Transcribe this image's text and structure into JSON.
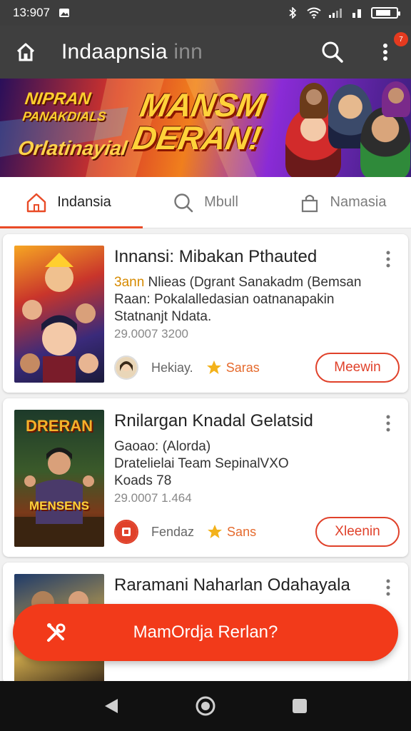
{
  "status": {
    "time": "13:907"
  },
  "appbar": {
    "title": "Indaapnsia",
    "title_suffix": "inn",
    "notification_count": "7"
  },
  "banner": {
    "left_line1": "NIPRAN",
    "left_line2": "PANAKDIALS",
    "left_line3": "Orlatinayial",
    "headline_line1": "MANSM",
    "headline_line2": "DERAN!"
  },
  "tabs": [
    {
      "label": "Indansia"
    },
    {
      "label": "Mbull"
    },
    {
      "label": "Namasia"
    }
  ],
  "cards": [
    {
      "title": "Innansi: Mibakan Pthauted",
      "desc_highlight": "3ann",
      "desc_line1": " Nlieas (Dgrant Sanakadm (Bemsan",
      "desc_line2": "Raan: Pokalalledasian oatnanapakin",
      "desc_line3": "Statnanjt Ndata.",
      "date": "29.0007 3200",
      "author": "Hekiay.",
      "rating": "Saras",
      "cta": "Meewin",
      "thumb_text": ""
    },
    {
      "title": "Rnilargan Knadal Gelatsid",
      "desc_highlight": "",
      "desc_line1": "Gaoao: (Alorda)",
      "desc_line2": "Dratelielai Team SepinalVXO",
      "desc_line3": "Koads 78",
      "date": "29.0007 1.464",
      "author": "Fendaz",
      "rating": "Sans",
      "cta": "Xleenin",
      "thumb_text_top": "DRERAN",
      "thumb_text_bottom": "MENSENS"
    },
    {
      "title": "Raramani Naharlan Odahayala"
    }
  ],
  "fab": {
    "label": "MamOrdja Rerlan?"
  },
  "colors": {
    "accent": "#f23a1a",
    "appbar": "#3f3f3f",
    "tab_indicator": "#e94b27"
  }
}
